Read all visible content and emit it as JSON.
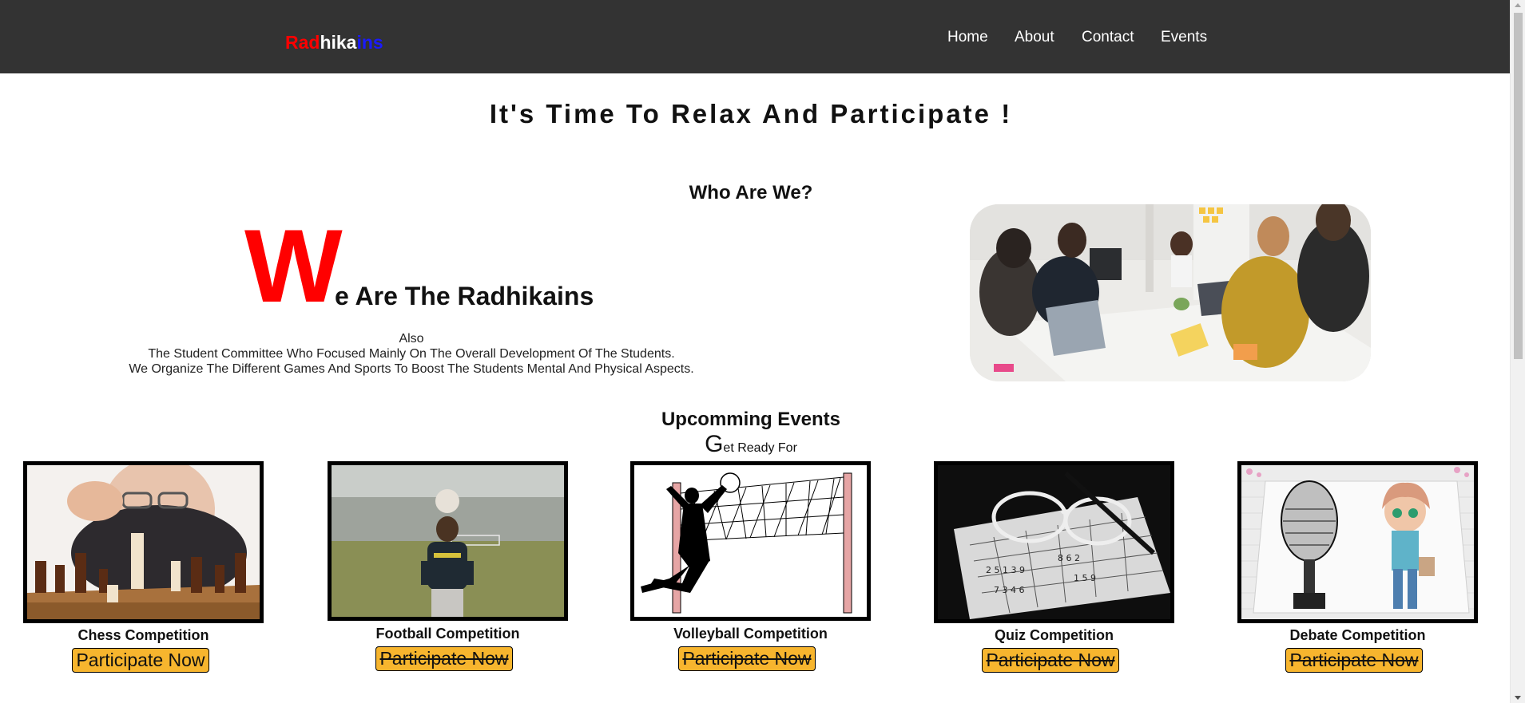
{
  "navbar": {
    "brand": {
      "part1": "Rad",
      "part2": "hika",
      "part3": "ins"
    },
    "links": [
      "Home",
      "About",
      "Contact",
      "Events"
    ]
  },
  "hero": {
    "title": "It's Time To Relax And Participate !"
  },
  "about": {
    "heading": "Who Are We?",
    "big_letter": "W",
    "headline_rest": "e Are The Radhikains",
    "lines": [
      "Also",
      "The Student Committee Who Focused Mainly On The Overall Development Of The Students.",
      "We Organize The Different Games And Sports To Boost The Students Mental And Physical Aspects."
    ]
  },
  "events": {
    "heading": "Upcomming Events",
    "sub_cap": "G",
    "sub_rest": "et Ready For",
    "cards": [
      {
        "title": "Chess Competition",
        "button": "Participate Now"
      },
      {
        "title": "Football Competition",
        "button": "Participate Now"
      },
      {
        "title": "Volleyball Competition",
        "button": "Participate Now"
      },
      {
        "title": "Quiz Competition",
        "button": "Participate Now"
      },
      {
        "title": "Debate Competition",
        "button": "Participate Now"
      }
    ]
  },
  "colors": {
    "navbar_bg": "#333333",
    "brand_red": "#ff0000",
    "brand_blue": "#1a1aff",
    "button_bg": "#f7b52e"
  }
}
